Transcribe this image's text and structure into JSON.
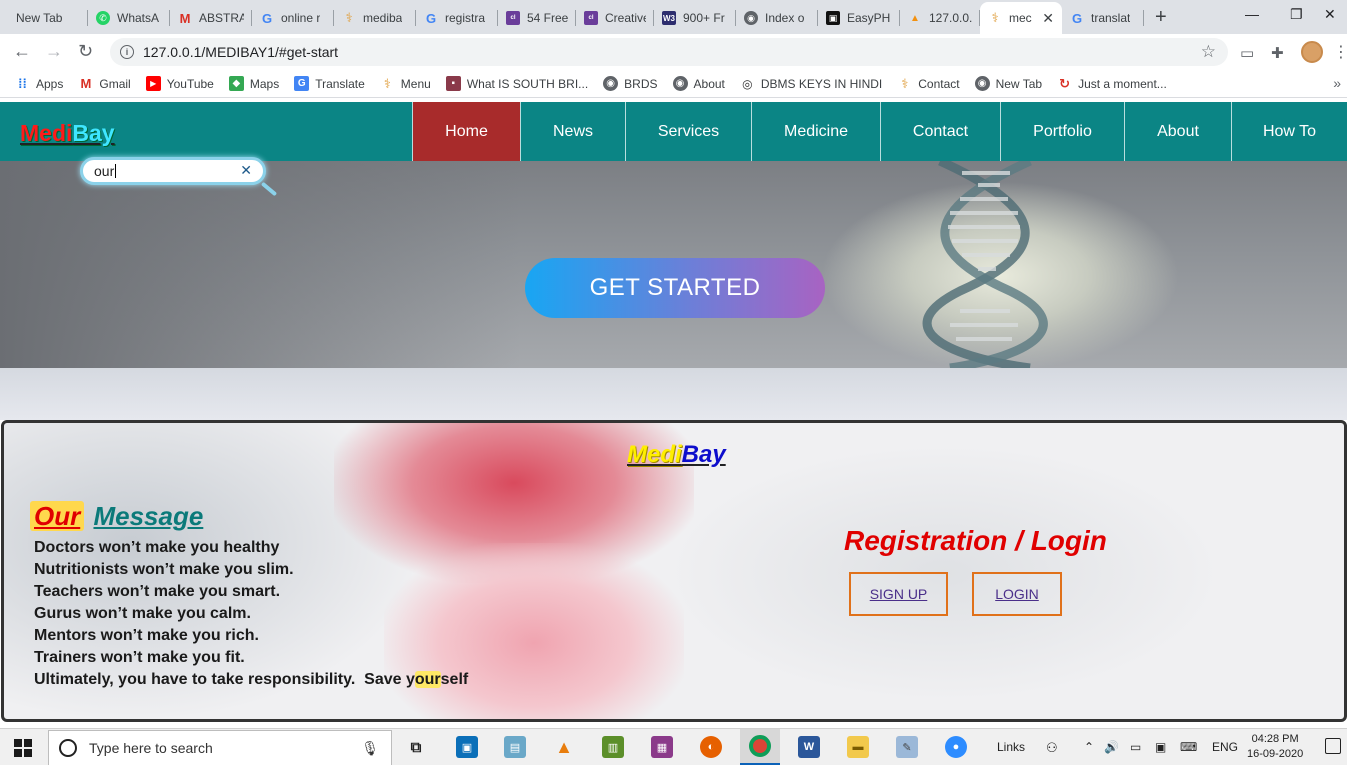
{
  "browser": {
    "tabs": [
      {
        "title": "New Tab"
      },
      {
        "title": "WhatsA"
      },
      {
        "title": "ABSTRA"
      },
      {
        "title": "online r"
      },
      {
        "title": "mediba"
      },
      {
        "title": "registra"
      },
      {
        "title": "54 Free"
      },
      {
        "title": "Creative"
      },
      {
        "title": "900+ Fr"
      },
      {
        "title": "Index o"
      },
      {
        "title": "EasyPH"
      },
      {
        "title": "127.0.0."
      },
      {
        "title": "mec"
      },
      {
        "title": "translat"
      }
    ],
    "url": "127.0.0.1/MEDIBAY1/#get-start",
    "bookmarks": [
      {
        "label": "Apps"
      },
      {
        "label": "Gmail"
      },
      {
        "label": "YouTube"
      },
      {
        "label": "Maps"
      },
      {
        "label": "Translate"
      },
      {
        "label": "Menu"
      },
      {
        "label": "What IS SOUTH BRI..."
      },
      {
        "label": "BRDS"
      },
      {
        "label": "About"
      },
      {
        "label": "DBMS KEYS IN HINDI"
      },
      {
        "label": "Contact"
      },
      {
        "label": "New Tab"
      },
      {
        "label": "Just a moment..."
      }
    ]
  },
  "site": {
    "logo": {
      "part1": "Medi",
      "part2": "Bay"
    },
    "nav": [
      {
        "label": "Home",
        "active": true
      },
      {
        "label": "News"
      },
      {
        "label": "Services"
      },
      {
        "label": "Medicine"
      },
      {
        "label": "Contact"
      },
      {
        "label": "Portfolio"
      },
      {
        "label": "About"
      },
      {
        "label": "How To"
      }
    ],
    "search": {
      "value": "our"
    },
    "hero": {
      "cta": "GET STARTED"
    },
    "brand": {
      "part1": "Medi",
      "part2": "Bay"
    },
    "message": {
      "title_highlight": "Our",
      "title_rest": "Message",
      "lines": [
        "Doctors won’t make you healthy",
        "Nutritionists won’t make you slim.",
        "Teachers won’t make you smart.",
        "Gurus won’t make you calm.",
        "Mentors won’t make you rich.",
        "Trainers won’t make you fit."
      ],
      "last_line_prefix": "Ultimately, you have to take responsibility.  Save y",
      "last_line_highlight": "our",
      "last_line_suffix": "self"
    },
    "auth": {
      "title": "Registration / Login",
      "signup": "SIGN UP",
      "login": "LOGIN"
    }
  },
  "taskbar": {
    "search_placeholder": "Type here to search",
    "links_label": "Links",
    "language": "ENG",
    "time": "04:28 PM",
    "date": "16-09-2020"
  }
}
